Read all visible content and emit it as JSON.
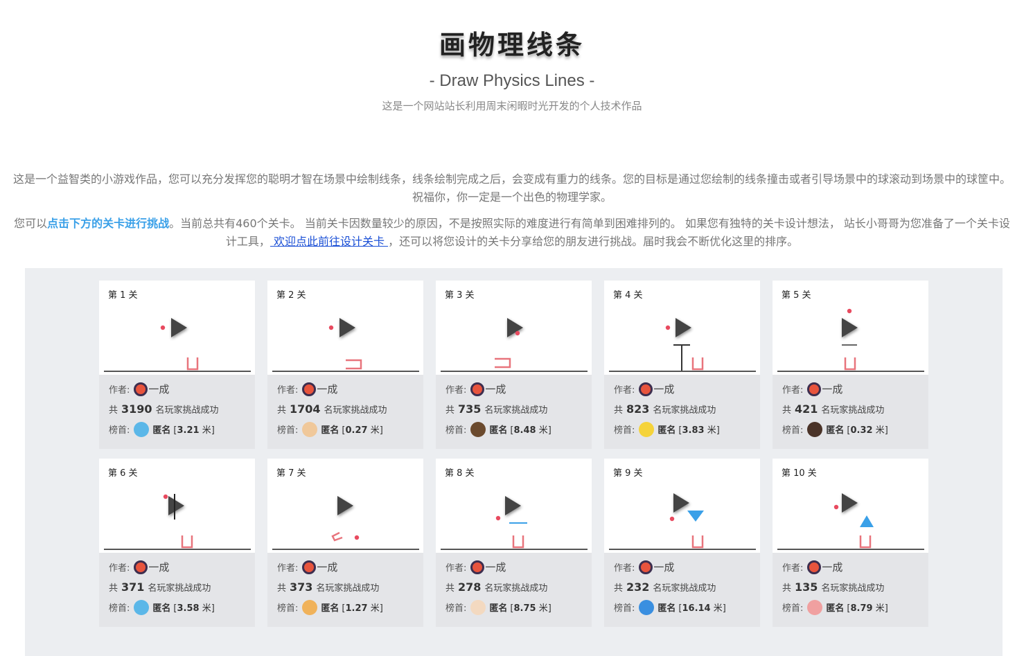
{
  "header": {
    "title": "画物理线条",
    "subtitle": "- Draw Physics Lines -",
    "tagline": "这是一个网站站长利用周末闲暇时光开发的个人技术作品"
  },
  "intro": {
    "p1": "这是一个益智类的小游戏作品，您可以充分发挥您的聪明才智在场景中绘制线条，线条绘制完成之后，会变成有重力的线条。您的目标是通过您绘制的线条撞击或者引导场景中的球滚动到场景中的球筐中。 祝福你，你一定是一个出色的物理学家。",
    "p2_a": "您可以",
    "p2_highlight": "点击下方的关卡进行挑战",
    "p2_b": "。当前总共有460个关卡。 当前关卡因数量较少的原因，不是按照实际的难度进行有简单到困难排列的。 如果您有独特的关卡设计想法， 站长小哥哥为您准备了一个关卡设计工具，",
    "p2_link": " 欢迎点此前往设计关卡 ",
    "p2_c": "，还可以将您设计的关卡分享给您的朋友进行挑战。届时我会不断优化这里的排序。"
  },
  "labels": {
    "author": "作者:",
    "count_prefix": "共",
    "count_suffix": "名玩家挑战成功",
    "leader": "榜首:",
    "meter_unit": "米"
  },
  "colors": {
    "ball": "#e84a5f",
    "basket": "#e8747c",
    "accent_blue": "#3aa0e8",
    "ground": "#555555",
    "play_icon": "#444444"
  },
  "levels": [
    {
      "label": "第 1 关",
      "author": "一成",
      "count": "3190",
      "player": "匿名",
      "score": "3.21",
      "avatar_color": "#5bb7e8"
    },
    {
      "label": "第 2 关",
      "author": "一成",
      "count": "1704",
      "player": "匿名",
      "score": "0.27",
      "avatar_color": "#f0c89a"
    },
    {
      "label": "第 3 关",
      "author": "一成",
      "count": "735",
      "player": "匿名",
      "score": "8.48",
      "avatar_color": "#6b4a2e"
    },
    {
      "label": "第 4 关",
      "author": "一成",
      "count": "823",
      "player": "匿名",
      "score": "3.83",
      "avatar_color": "#f5d33a"
    },
    {
      "label": "第 5 关",
      "author": "一成",
      "count": "421",
      "player": "匿名",
      "score": "0.32",
      "avatar_color": "#4a3328"
    },
    {
      "label": "第 6 关",
      "author": "一成",
      "count": "371",
      "player": "匿名",
      "score": "3.58",
      "avatar_color": "#5bb7e8"
    },
    {
      "label": "第 7 关",
      "author": "一成",
      "count": "373",
      "player": "匿名",
      "score": "1.27",
      "avatar_color": "#f0b25a"
    },
    {
      "label": "第 8 关",
      "author": "一成",
      "count": "278",
      "player": "匿名",
      "score": "8.75",
      "avatar_color": "#f3d9c0"
    },
    {
      "label": "第 9 关",
      "author": "一成",
      "count": "232",
      "player": "匿名",
      "score": "16.14",
      "avatar_color": "#3a8fe0"
    },
    {
      "label": "第 10 关",
      "author": "一成",
      "count": "135",
      "player": "匿名",
      "score": "8.79",
      "avatar_color": "#f0a0a0"
    }
  ]
}
